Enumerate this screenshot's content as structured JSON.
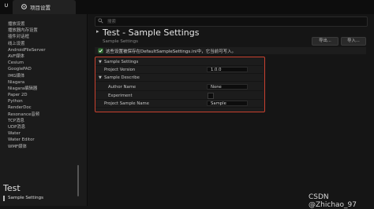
{
  "window": {
    "app_logo": "U",
    "tab_title": "项目设置"
  },
  "sidebar": {
    "items": [
      "播放设置",
      "播放器内存设置",
      "插件对话框",
      "线上设置",
      "AndroidFileServer",
      "AVF媒体",
      "Cesium",
      "GooglePAD",
      "IMG媒体",
      "Niagara",
      "Niagara编辑器",
      "Paper 2D",
      "Python",
      "RenderDoc",
      "Resonance音频",
      "TCP消息",
      "UDP消息",
      "Water",
      "Water Editor",
      "WMF媒体"
    ],
    "section_title": "Test",
    "selected_item": "Sample Settings"
  },
  "search": {
    "placeholder": "搜索"
  },
  "header": {
    "title_arrow": "▸",
    "title": "Test - Sample Settings",
    "subtitle": "Sample Settings",
    "export_label": "导出...",
    "import_label": "导入..."
  },
  "notice": {
    "text": "这些设置被保存在DefaultSampleSettings.ini中，它当前可写入。",
    "right_text": ""
  },
  "details": {
    "category": "Sample Settings",
    "project_version_label": "Project Version",
    "project_version_value": "1.0.0",
    "describe_label": "Sample Describe",
    "author_label": "Author Name",
    "author_value": "None",
    "experiment_label": "Experiment",
    "project_sample_name_label": "Project Sample Name",
    "project_sample_name_value": "Sample"
  },
  "watermark": "CSDN @Zhichao_97",
  "colors": {
    "highlight_border": "#c9412f",
    "background": "#151515"
  }
}
